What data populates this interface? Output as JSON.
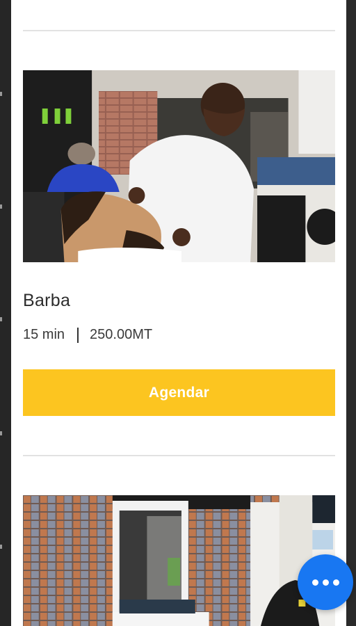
{
  "service": {
    "title": "Barba",
    "duration": "15 min",
    "price": "250.00MT",
    "book_label": "Agendar",
    "image_icon": "barber-photo"
  },
  "next_service": {
    "image_icon": "salon-photo"
  },
  "fab": {
    "icon": "more-options-icon",
    "color": "#1877f2"
  },
  "colors": {
    "accent": "#fcc520",
    "divider": "#e2e2e2"
  }
}
